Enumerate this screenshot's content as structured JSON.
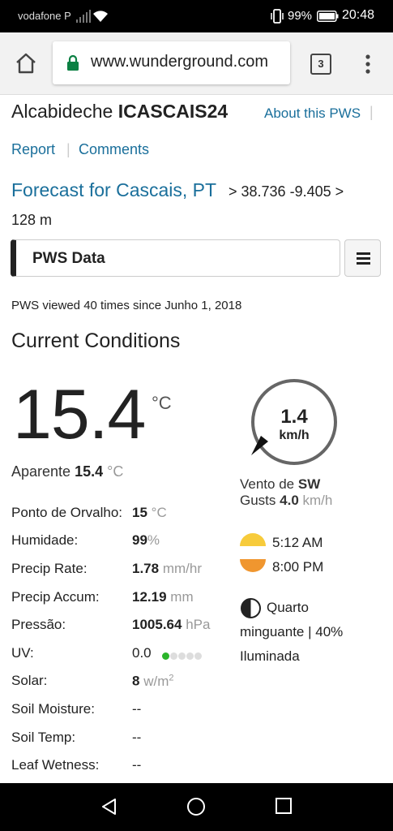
{
  "status": {
    "carrier": "vodafone P",
    "battery": "99%",
    "time": "20:48"
  },
  "browser": {
    "url": "www.wunderground.com",
    "tab_count": "3"
  },
  "station": {
    "city": "Alcabideche",
    "id": "ICASCAIS24",
    "about_link": "About this PWS",
    "report_link": "Report",
    "comments_link": "Comments",
    "forecast_link": "Forecast for Cascais, PT",
    "coords": "> 38.736 -9.405 >",
    "elevation": "128 m"
  },
  "pws_selector": {
    "label": "PWS Data"
  },
  "viewed_text": "PWS viewed 40 times since Junho 1, 2018",
  "current": {
    "heading": "Current Conditions",
    "temp": "15.4",
    "temp_unit": "°C",
    "feels_label": "Aparente",
    "feels_value": "15.4",
    "feels_unit": "°C"
  },
  "wind": {
    "speed": "1.4",
    "unit": "km/h",
    "dir_label": "Vento de",
    "dir": "SW",
    "gusts_label": "Gusts",
    "gusts_value": "4.0",
    "gusts_unit": "km/h"
  },
  "rows": [
    {
      "label": "Ponto de Orvalho:",
      "value": "15",
      "unit": "°C"
    },
    {
      "label": "Humidade:",
      "value": "99",
      "unit": "%"
    },
    {
      "label": "Precip Rate:",
      "value": "1.78",
      "unit": "mm/hr"
    },
    {
      "label": "Precip Accum:",
      "value": "12.19",
      "unit": "mm"
    },
    {
      "label": "Pressão:",
      "value": "1005.64",
      "unit": "hPa"
    },
    {
      "label": "UV:",
      "value": "0.0",
      "unit": ""
    },
    {
      "label": "Solar:",
      "value": "8",
      "unit": "w/m",
      "unit_sup": "2"
    },
    {
      "label": "Soil Moisture:",
      "value": "--",
      "unit": ""
    },
    {
      "label": "Soil Temp:",
      "value": "--",
      "unit": ""
    },
    {
      "label": "Leaf Wetness:",
      "value": "--",
      "unit": ""
    }
  ],
  "uv_level": {
    "active": 1,
    "total": 5
  },
  "astro": {
    "sunrise": "5:12 AM",
    "sunset": "8:00 PM",
    "moon_line1": "Quarto",
    "moon_line2": "minguante | 40%",
    "moon_line3": "Iluminada"
  },
  "colors": {
    "link": "#1a6f9b",
    "sun_yellow": "#f7cb3b",
    "sun_orange": "#f0962f",
    "uv_green": "#2bb52b"
  }
}
